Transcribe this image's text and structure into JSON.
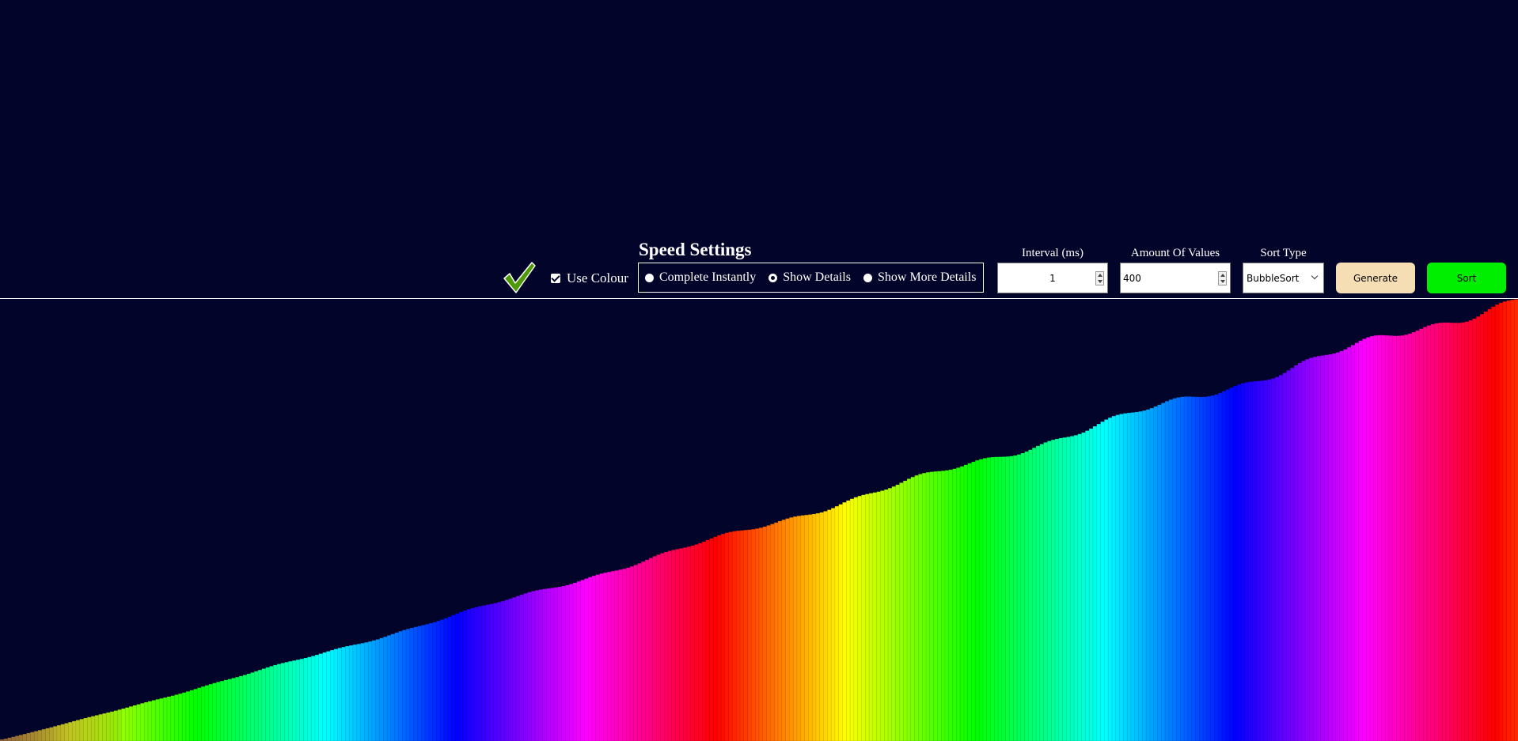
{
  "controls": {
    "use_colour_label": "Use Colour",
    "use_colour_checked": true,
    "speed_title": "Speed Settings",
    "speed_options": [
      {
        "label": "Complete Instantly",
        "selected": false
      },
      {
        "label": "Show Details",
        "selected": true
      },
      {
        "label": "Show More Details",
        "selected": false
      }
    ],
    "interval_label": "Interval (ms)",
    "interval_value": "1",
    "amount_label": "Amount Of Values",
    "amount_value": "400",
    "sort_type_label": "Sort Type",
    "sort_type_value": "BubbleSort",
    "generate_label": "Generate",
    "sort_label": "Sort"
  },
  "colors": {
    "background": "#03042a",
    "generate_button": "#f5deb3",
    "sort_button": "#00ee00",
    "checkmark": "#4e9a06"
  },
  "icons": {
    "status": "checkmark-icon"
  },
  "chart_data": {
    "type": "bar",
    "bar_count": 400,
    "values_sorted_ascending": true,
    "value_range": [
      1,
      559
    ],
    "color_mode": "hue rainbow by value"
  }
}
